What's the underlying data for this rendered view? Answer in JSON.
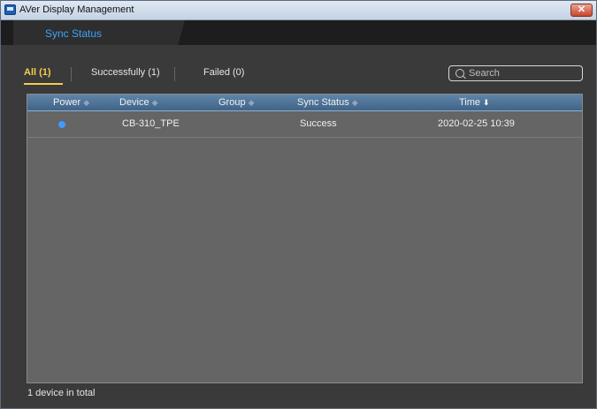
{
  "window": {
    "title": "AVer Display Management",
    "close_glyph": "✕"
  },
  "tabs": [
    {
      "label": "Sync Status"
    }
  ],
  "filters": [
    {
      "label": "All (1)"
    },
    {
      "label": "Successfully (1)"
    },
    {
      "label": "Failed (0)"
    }
  ],
  "search": {
    "placeholder": "Search"
  },
  "table": {
    "columns": [
      {
        "label": "Power",
        "sort": "◆"
      },
      {
        "label": "Device",
        "sort": "◆"
      },
      {
        "label": "Group",
        "sort": "◆"
      },
      {
        "label": "Sync Status",
        "sort": "◆"
      },
      {
        "label": "Time",
        "sort": "⬇"
      }
    ],
    "rows": [
      {
        "power": "on",
        "device": "CB-310_TPE",
        "group": "",
        "sync_status": "Success",
        "time": "2020-02-25 10:39"
      }
    ]
  },
  "footer": {
    "count_text": "1 device in total"
  },
  "colors": {
    "accent": "#f4cd4b",
    "tab_text": "#3aa5ff",
    "header": "#4b6f94",
    "power_on": "#3f9bff"
  }
}
